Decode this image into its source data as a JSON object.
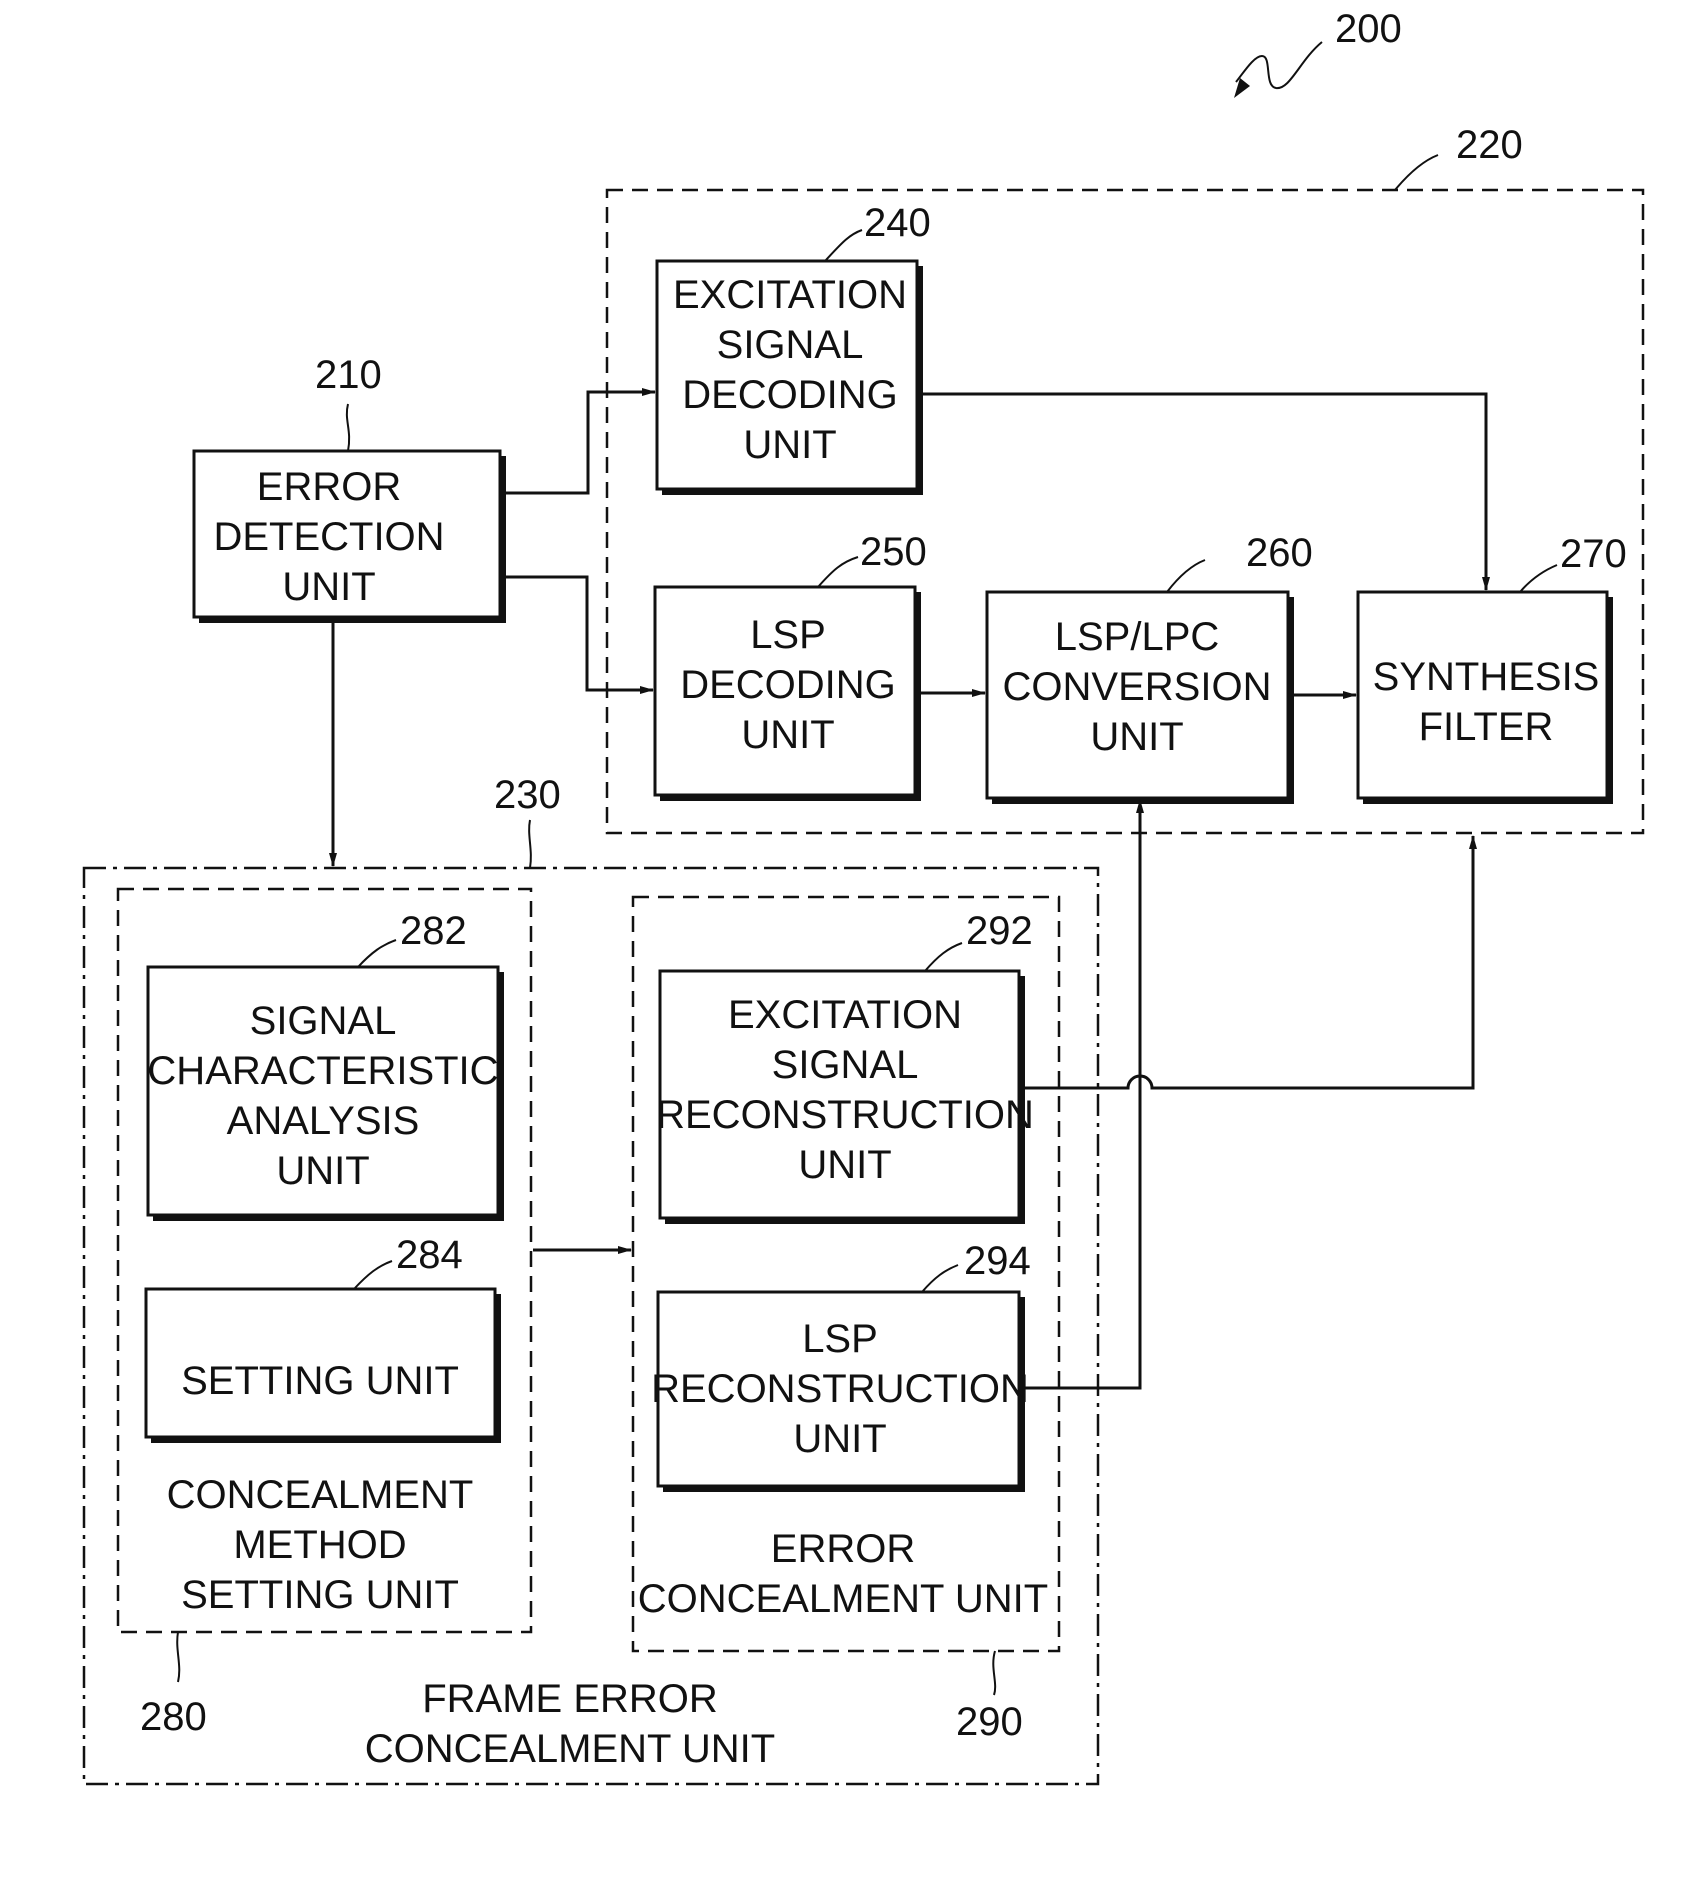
{
  "figure": {
    "ref": "200"
  },
  "groups": {
    "decoder": {
      "ref": "220"
    },
    "frame_error_concealment": {
      "ref": "230",
      "label": [
        "FRAME ERROR",
        "CONCEALMENT UNIT"
      ]
    },
    "concealment_method_setting": {
      "ref": "280",
      "label": [
        "CONCEALMENT",
        "METHOD",
        "SETTING UNIT"
      ]
    },
    "error_concealment": {
      "ref": "290",
      "label": [
        "ERROR",
        "CONCEALMENT UNIT"
      ]
    }
  },
  "blocks": {
    "error_detection": {
      "ref": "210",
      "label": [
        "ERROR",
        "DETECTION",
        "UNIT"
      ]
    },
    "excitation_decoding": {
      "ref": "240",
      "label": [
        "EXCITATION",
        "SIGNAL",
        "DECODING",
        "UNIT"
      ]
    },
    "lsp_decoding": {
      "ref": "250",
      "label": [
        "LSP",
        "DECODING",
        "UNIT"
      ]
    },
    "lsp_lpc_conversion": {
      "ref": "260",
      "label": [
        "LSP/LPC",
        "CONVERSION",
        "UNIT"
      ]
    },
    "synthesis_filter": {
      "ref": "270",
      "label": [
        "SYNTHESIS",
        "FILTER"
      ]
    },
    "signal_characteristic_analysis": {
      "ref": "282",
      "label": [
        "SIGNAL",
        "CHARACTERISTIC",
        "ANALYSIS",
        "UNIT"
      ]
    },
    "setting": {
      "ref": "284",
      "label": [
        "SETTING UNIT"
      ]
    },
    "excitation_reconstruction": {
      "ref": "292",
      "label": [
        "EXCITATION",
        "SIGNAL",
        "RECONSTRUCTION",
        "UNIT"
      ]
    },
    "lsp_reconstruction": {
      "ref": "294",
      "label": [
        "LSP",
        "RECONSTRUCTION",
        "UNIT"
      ]
    }
  },
  "connections": [
    {
      "from": "210",
      "to": "240"
    },
    {
      "from": "210",
      "to": "250"
    },
    {
      "from": "210",
      "to": "230"
    },
    {
      "from": "240",
      "to": "270"
    },
    {
      "from": "250",
      "to": "260"
    },
    {
      "from": "260",
      "to": "270"
    },
    {
      "from": "280",
      "to": "290"
    },
    {
      "from": "292",
      "to": "270"
    },
    {
      "from": "294",
      "to": "260"
    }
  ]
}
